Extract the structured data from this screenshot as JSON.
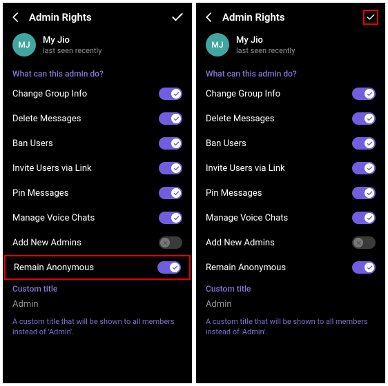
{
  "left": {
    "header": {
      "title": "Admin Rights"
    },
    "user": {
      "initials": "MJ",
      "name": "My Jio",
      "status": "last seen recently"
    },
    "section_label": "What can this admin do?",
    "permissions": [
      {
        "label": "Change Group Info",
        "on": true
      },
      {
        "label": "Delete Messages",
        "on": true
      },
      {
        "label": "Ban Users",
        "on": true
      },
      {
        "label": "Invite Users via Link",
        "on": true
      },
      {
        "label": "Pin Messages",
        "on": true
      },
      {
        "label": "Manage Voice Chats",
        "on": true
      },
      {
        "label": "Add New Admins",
        "on": false,
        "disabled": true
      },
      {
        "label": "Remain Anonymous",
        "on": true,
        "highlight": true
      }
    ],
    "custom_title_label": "Custom title",
    "custom_title_value": "Admin",
    "helper": "A custom title that will be shown to all members instead of 'Admin'."
  },
  "right": {
    "header": {
      "title": "Admin Rights",
      "check_highlight": true
    },
    "user": {
      "initials": "MJ",
      "name": "My Jio",
      "status": "last seen recently"
    },
    "section_label": "What can this admin do?",
    "permissions": [
      {
        "label": "Change Group Info",
        "on": true
      },
      {
        "label": "Delete Messages",
        "on": true
      },
      {
        "label": "Ban Users",
        "on": true
      },
      {
        "label": "Invite Users via Link",
        "on": true
      },
      {
        "label": "Pin Messages",
        "on": true
      },
      {
        "label": "Manage Voice Chats",
        "on": true
      },
      {
        "label": "Add New Admins",
        "on": false,
        "disabled": true
      },
      {
        "label": "Remain Anonymous",
        "on": true
      }
    ],
    "custom_title_label": "Custom title",
    "custom_title_value": "Admin",
    "helper": "A custom title that will be shown to all members instead of 'Admin'."
  }
}
